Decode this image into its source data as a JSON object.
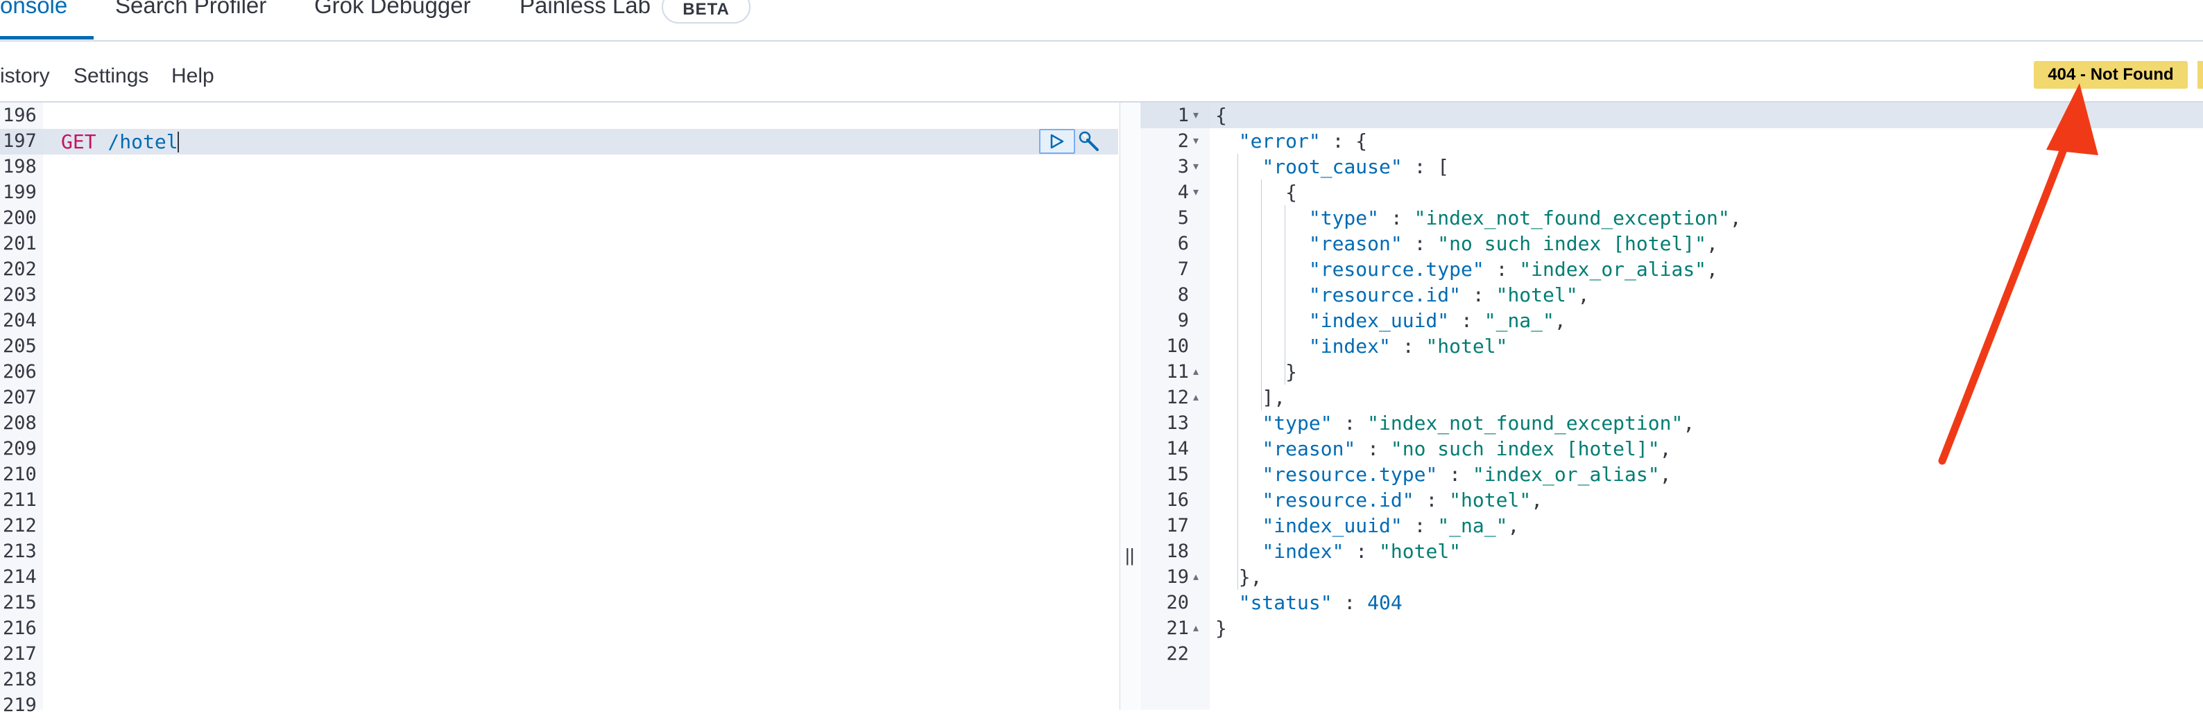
{
  "tabs": [
    {
      "label": "onsole"
    },
    {
      "label": "Search Profiler"
    },
    {
      "label": "Grok Debugger"
    },
    {
      "label": "Painless Lab"
    }
  ],
  "beta_badge": "BETA",
  "toolbar": {
    "history": "istory",
    "settings": "Settings",
    "help": "Help"
  },
  "status_badge": "404 - Not Found",
  "editor": {
    "line_numbers": [
      "196",
      "197",
      "198",
      "199",
      "200",
      "201",
      "202",
      "203",
      "204",
      "205",
      "206",
      "207",
      "208",
      "209",
      "210",
      "211",
      "212",
      "213",
      "214",
      "215",
      "216",
      "217",
      "218",
      "219"
    ],
    "method": "GET",
    "path": " /hotel"
  },
  "output": {
    "line_numbers": [
      "1",
      "2",
      "3",
      "4",
      "5",
      "6",
      "7",
      "8",
      "9",
      "10",
      "11",
      "12",
      "13",
      "14",
      "15",
      "16",
      "17",
      "18",
      "19",
      "20",
      "21",
      "22"
    ],
    "lines": [
      "{",
      "  \"error\" : {",
      "    \"root_cause\" : [",
      "      {",
      "        \"type\" : \"index_not_found_exception\",",
      "        \"reason\" : \"no such index [hotel]\",",
      "        \"resource.type\" : \"index_or_alias\",",
      "        \"resource.id\" : \"hotel\",",
      "        \"index_uuid\" : \"_na_\",",
      "        \"index\" : \"hotel\"",
      "      }",
      "    ],",
      "    \"type\" : \"index_not_found_exception\",",
      "    \"reason\" : \"no such index [hotel]\",",
      "    \"resource.type\" : \"index_or_alias\",",
      "    \"resource.id\" : \"hotel\",",
      "    \"index_uuid\" : \"_na_\",",
      "    \"index\" : \"hotel\"",
      "  },",
      "  \"status\" : 404",
      "}",
      ""
    ]
  },
  "colors": {
    "accent": "#006bb4",
    "status_badge_bg": "#f1d86f",
    "annotation_arrow": "#f03a17"
  }
}
